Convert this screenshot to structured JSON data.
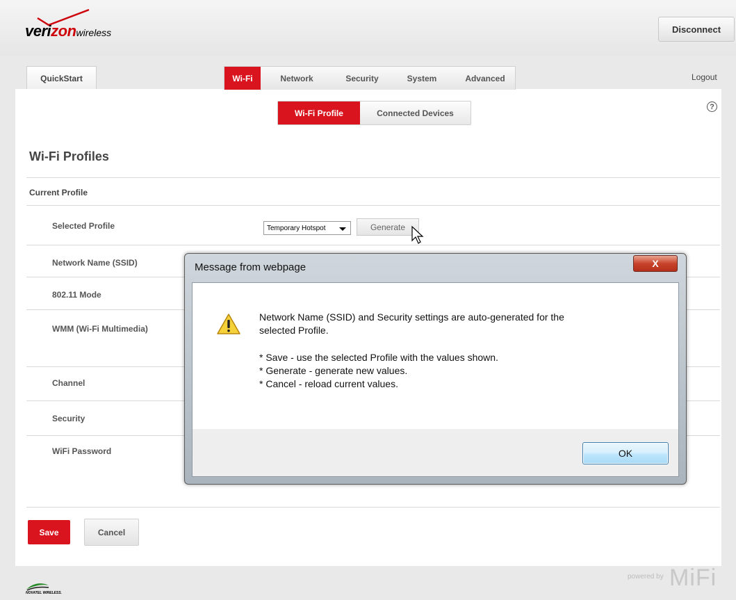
{
  "header": {
    "logo_main_pre": "veri",
    "logo_main_z": "zon",
    "logo_sub": "wireless",
    "disconnect_label": "Disconnect"
  },
  "nav": {
    "quickstart_label": "QuickStart",
    "tabs": [
      {
        "label": "Wi-Fi",
        "active": true
      },
      {
        "label": "Network",
        "active": false
      },
      {
        "label": "Security",
        "active": false
      },
      {
        "label": "System",
        "active": false
      },
      {
        "label": "Advanced",
        "active": false
      }
    ],
    "logout_label": "Logout"
  },
  "subtabs": [
    {
      "label": "Wi-Fi Profile",
      "active": true
    },
    {
      "label": "Connected Devices",
      "active": false
    }
  ],
  "help_icon": "?",
  "page_title": "Wi-Fi Profiles",
  "section_title": "Current Profile",
  "rows": [
    {
      "label": "Selected Profile"
    },
    {
      "label": "Network Name (SSID)"
    },
    {
      "label": "802.11 Mode"
    },
    {
      "label": "WMM (Wi-Fi Multimedia)"
    },
    {
      "label": "Channel"
    },
    {
      "label": "Security"
    },
    {
      "label": "WiFi Password"
    }
  ],
  "profile_select": {
    "value": "Temporary Hotspot"
  },
  "generate_label": "Generate",
  "actions": {
    "save_label": "Save",
    "cancel_label": "Cancel"
  },
  "footer": {
    "left_brand": "NOVATEL WIRELESS.",
    "powered_by": "powered by",
    "mifi": "MiFi"
  },
  "dialog": {
    "title": "Message from webpage",
    "close_label": "X",
    "message_lines": [
      "Network Name (SSID) and Security settings are auto-generated for the",
      "selected Profile.",
      "* Save - use the selected Profile with the values shown.",
      "* Generate - generate new values.",
      "* Cancel - reload current values."
    ],
    "ok_label": "OK"
  },
  "colors": {
    "accent": "#d9141e",
    "dialog_frame": "#b9c3cb"
  }
}
